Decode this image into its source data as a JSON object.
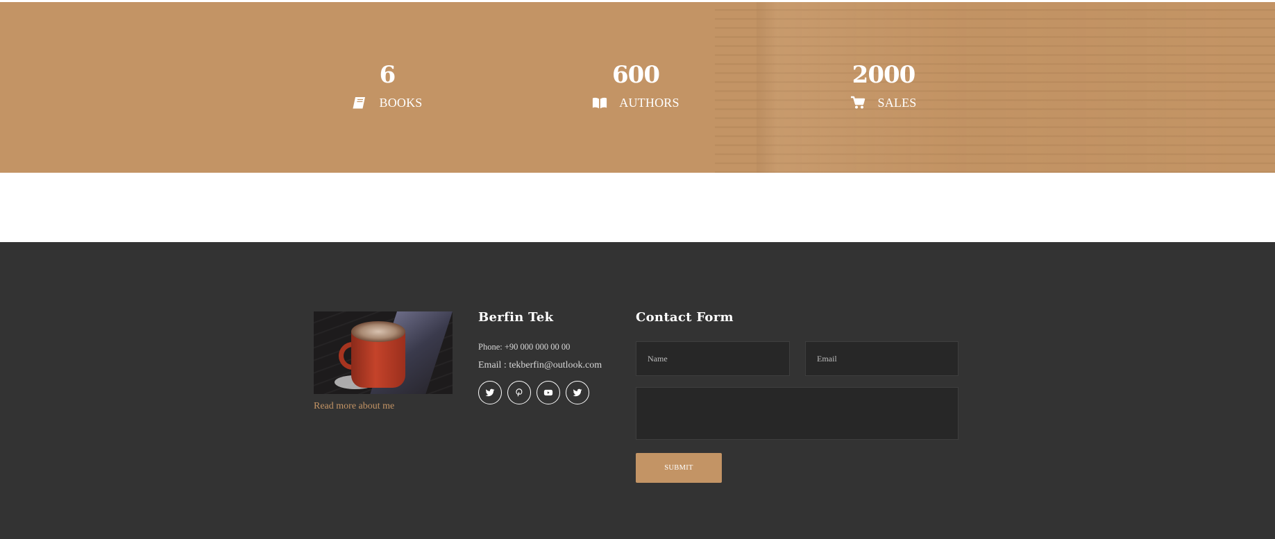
{
  "stats": [
    {
      "value": "6",
      "label": "BOOKS",
      "icon": "book-icon"
    },
    {
      "value": "600",
      "label": "AUTHORS",
      "icon": "open-book-icon"
    },
    {
      "value": "2000",
      "label": "SALES",
      "icon": "shopping-cart-icon"
    }
  ],
  "about": {
    "read_more": "Read more about me"
  },
  "contact_info": {
    "name": "Berfin Tek",
    "phone": "Phone: +90 000 000 00 00",
    "email": "Email : tekberfin@outlook.com",
    "socials": [
      "twitter-icon",
      "pinterest-icon",
      "youtube-icon",
      "twitter-icon"
    ]
  },
  "contact_form": {
    "title": "Contact Form",
    "name_placeholder": "Name",
    "email_placeholder": "Email",
    "message_placeholder": "",
    "submit_label": "SUBMIT"
  },
  "colors": {
    "accent": "#c39465",
    "footer_bg": "#333333",
    "field_bg": "#272727"
  }
}
